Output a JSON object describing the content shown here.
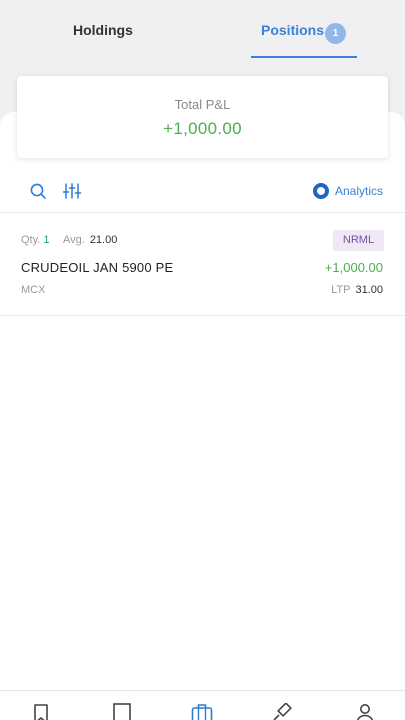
{
  "tabs": {
    "holdings_label": "Holdings",
    "positions_label": "Positions",
    "positions_count": "1"
  },
  "summary": {
    "total_pnl_label": "Total P&L",
    "total_pnl_value": "+1,000.00"
  },
  "toolbar": {
    "search_icon": "search-icon",
    "filter_icon": "sliders-icon",
    "analytics_label": "Analytics"
  },
  "positions": [
    {
      "qty_label": "Qty.",
      "qty_value": "1",
      "avg_label": "Avg.",
      "avg_value": "21.00",
      "product": "NRML",
      "instrument": "CRUDEOIL JAN 5900 PE",
      "pnl": "+1,000.00",
      "exchange": "MCX",
      "ltp_label": "LTP",
      "ltp_value": "31.00"
    }
  ],
  "bottom_nav": [
    "bookmark-icon",
    "book-icon",
    "briefcase-icon",
    "gavel-icon",
    "person-icon"
  ],
  "colors": {
    "accent": "#3b82d6",
    "profit": "#4caf50",
    "product_badge_bg": "#efe9f6",
    "product_badge_text": "#7a4ea3",
    "header_bg": "#f0f0f2"
  }
}
